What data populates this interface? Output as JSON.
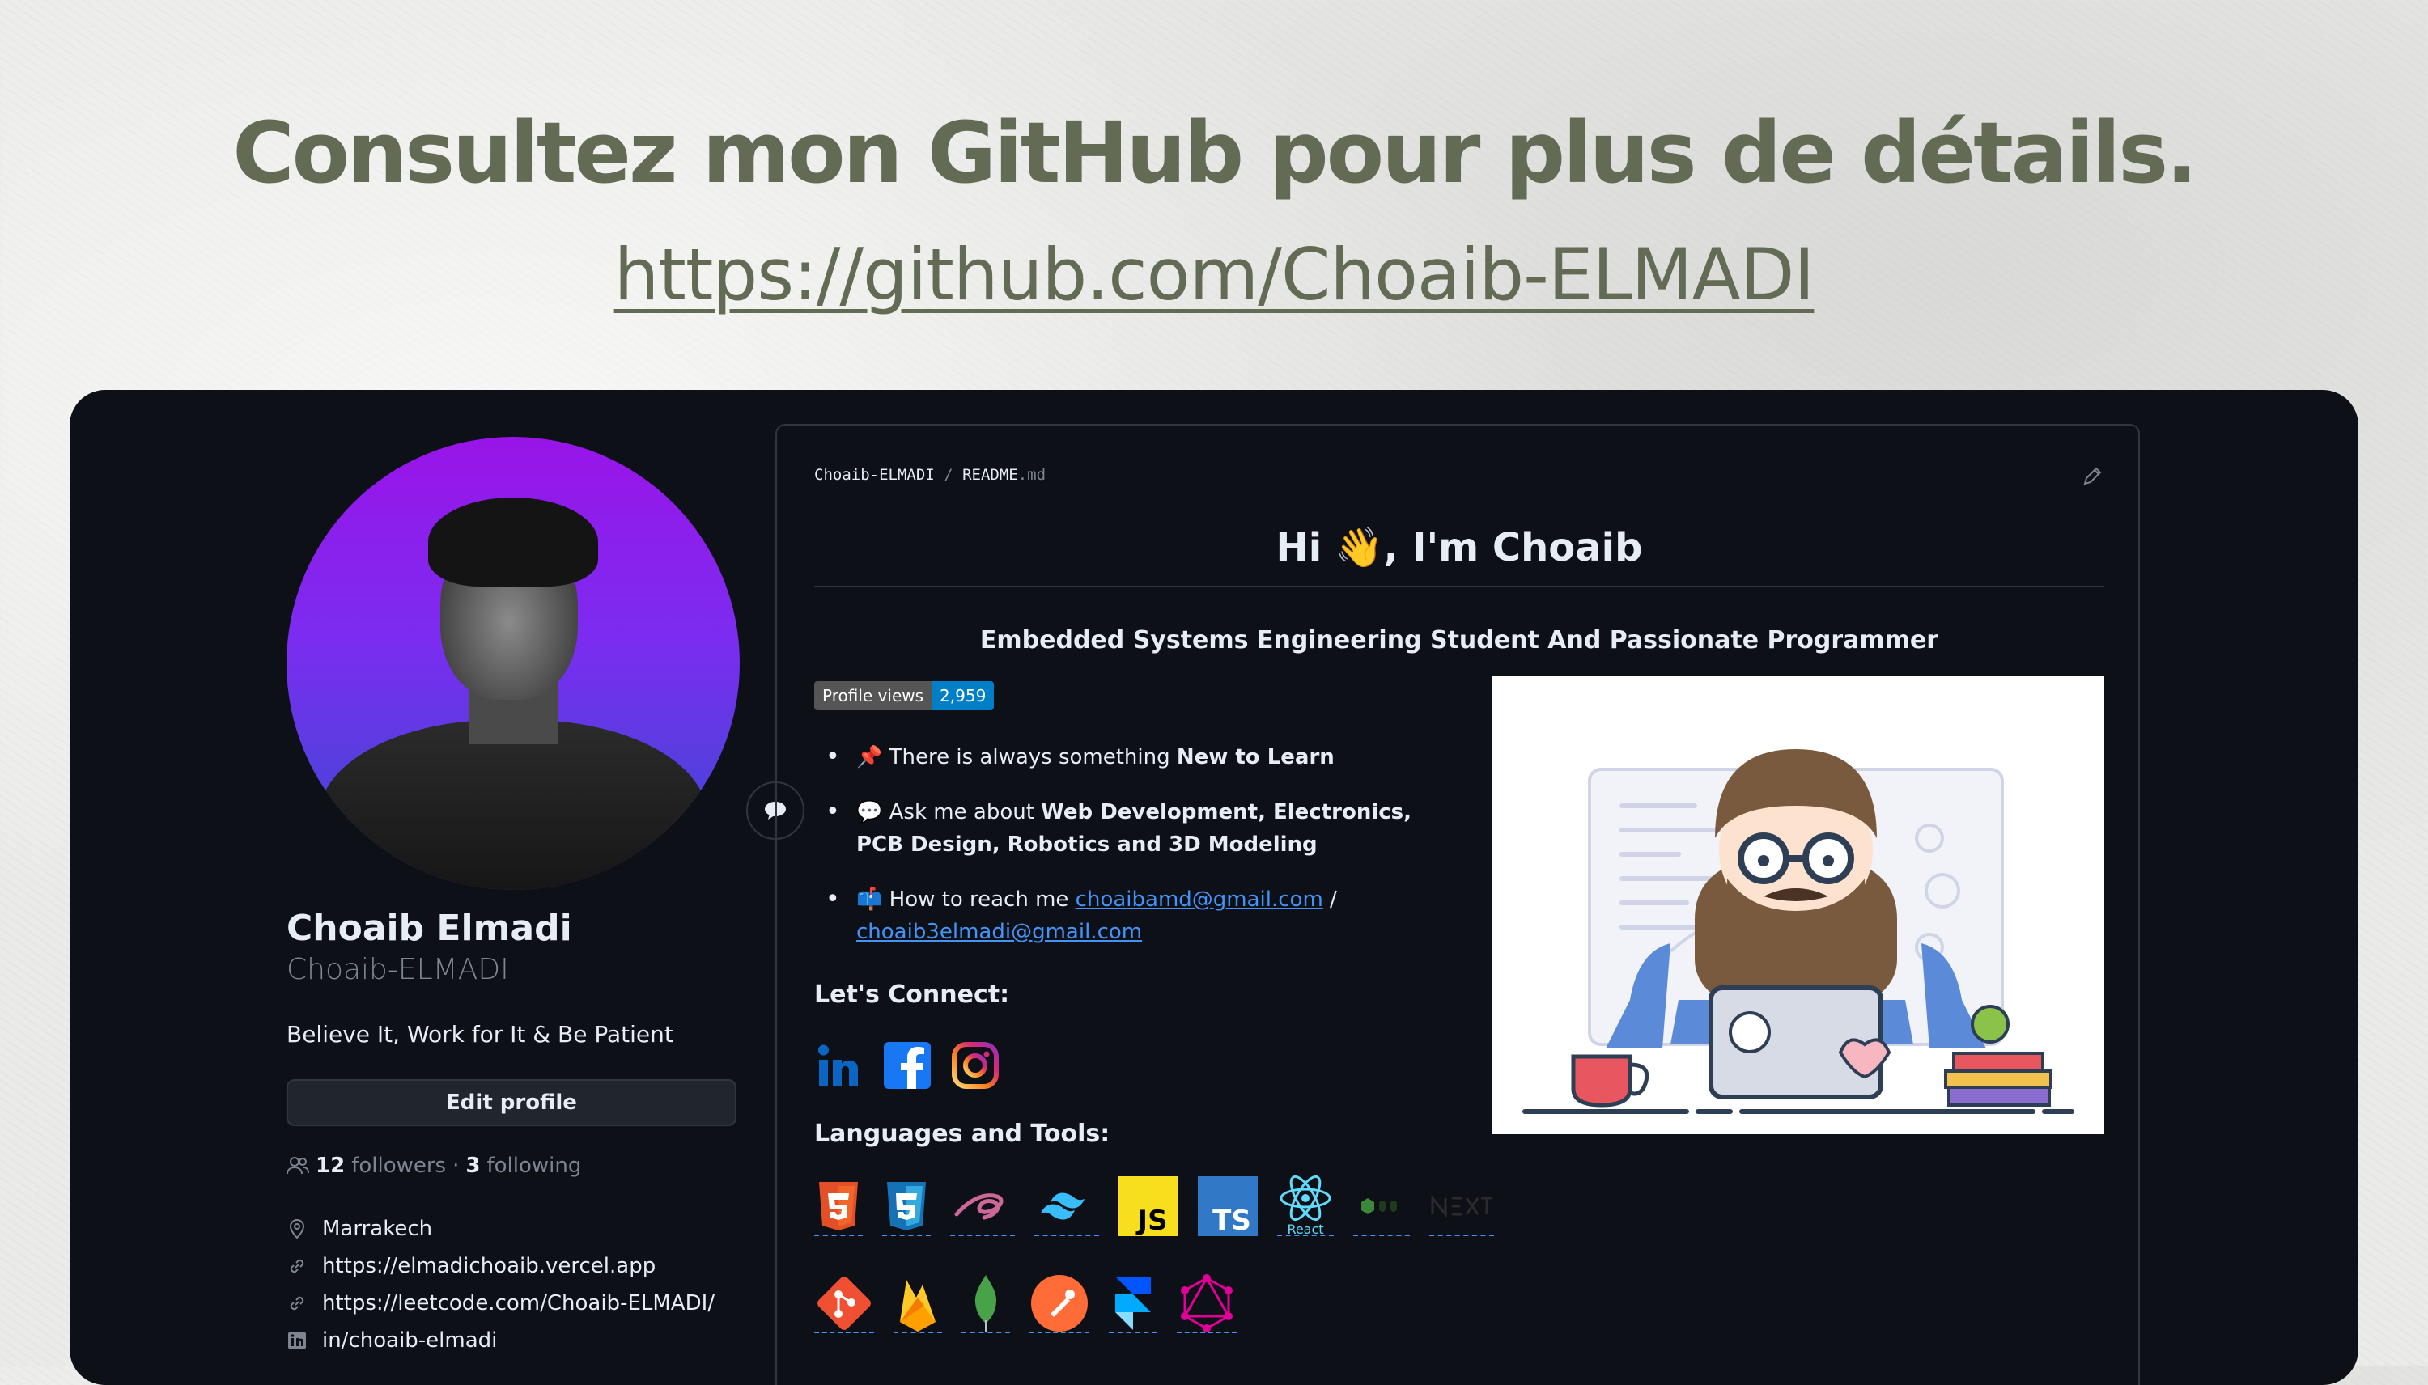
{
  "headline": "Consultez mon GitHub pour plus de détails.",
  "github_url": "https://github.com/Choaib-ELMADI",
  "profile": {
    "name": "Choaib Elmadi",
    "login": "Choaib-ELMADI",
    "bio": "Believe It, Work for It & Be Patient",
    "edit_label": "Edit profile",
    "followers_count": "12",
    "followers_label": "followers",
    "separator": "·",
    "following_count": "3",
    "following_label": "following",
    "location": "Marrakech",
    "website": "https://elmadichoaib.vercel.app",
    "leetcode": "https://leetcode.com/Choaib-ELMADI/",
    "linkedin": "in/choaib-elmadi"
  },
  "readme": {
    "crumb_user": "Choaib-ELMADI",
    "crumb_sep": "/",
    "crumb_file": "README",
    "crumb_ext": ".md",
    "greeting_pre": "Hi ",
    "greeting_emoji": "👋",
    "greeting_post": ", I'm Choaib",
    "subtitle": "Embedded Systems Engineering Student And Passionate Programmer",
    "badge_label": "Profile views",
    "badge_value": "2,959",
    "bullet1_pre": "There is always something ",
    "bullet1_bold": "New to Learn",
    "bullet2_pre": "Ask me about ",
    "bullet2_bold": "Web Development, Electronics, PCB Design, Robotics and 3D Modeling",
    "bullet3_pre": "How to reach me ",
    "email1": "choaibamd@gmail.com",
    "email_sep": " / ",
    "email2": "choaib3elmadi@gmail.com",
    "connect_title": "Let's Connect:",
    "tools_title": "Languages and Tools:"
  },
  "tools_row1": [
    "html5-icon",
    "css3-icon",
    "sass-icon",
    "tailwind-icon",
    "javascript-icon",
    "typescript-icon",
    "react-icon",
    "nodejs-icon",
    "nextjs-icon"
  ],
  "tools_row2": [
    "git-icon",
    "firebase-icon",
    "mongodb-icon",
    "postman-icon",
    "framer-icon",
    "graphql-icon"
  ],
  "icon_labels": {
    "js": "JS",
    "ts": "TS",
    "react": "React"
  },
  "colors": {
    "accent": "#636b55",
    "panel": "#0d1117",
    "link": "#4493f8",
    "badge_value_bg": "#007ec6"
  }
}
